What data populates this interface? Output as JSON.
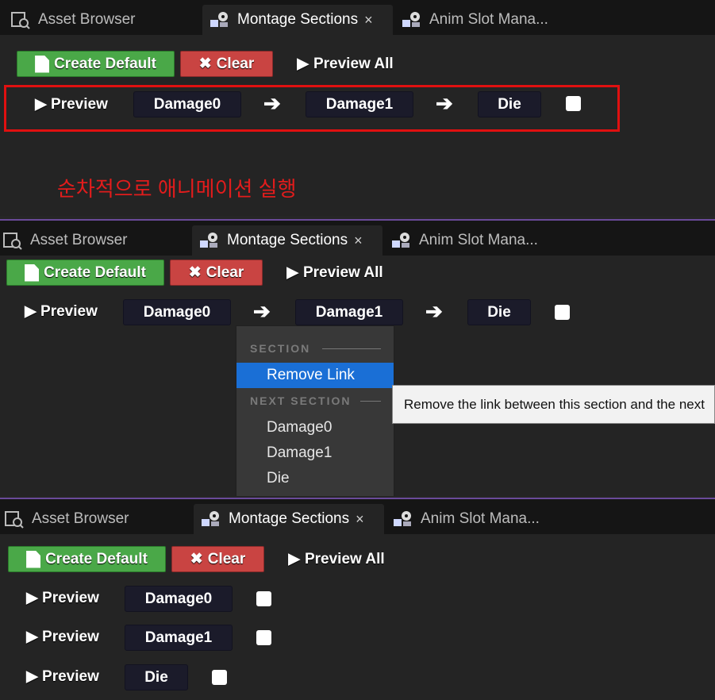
{
  "panels": [
    {
      "tabs": {
        "asset_browser": "Asset Browser",
        "montage_sections": "Montage Sections",
        "close": "×",
        "anim_slot": "Anim Slot Mana..."
      },
      "toolbar": {
        "create_default": "Create Default",
        "clear_glyph": "✖",
        "clear": "Clear",
        "preview_all_glyph": "▶",
        "preview_all": "Preview All"
      },
      "rows": [
        {
          "preview": "▶ Preview",
          "sections": [
            "Damage0",
            "Damage1",
            "Die"
          ],
          "arrow": "➔"
        }
      ],
      "caption": "순차적으로 애니메이션 실행"
    },
    {
      "tabs": {
        "asset_browser": "Asset Browser",
        "montage_sections": "Montage Sections",
        "close": "×",
        "anim_slot": "Anim Slot Mana..."
      },
      "toolbar": {
        "create_default": "Create Default",
        "clear_glyph": "✖",
        "clear": "Clear",
        "preview_all_glyph": "▶",
        "preview_all": "Preview All"
      },
      "rows": [
        {
          "preview": "▶ Preview",
          "sections": [
            "Damage0",
            "Damage1",
            "Die"
          ],
          "arrow": "➔"
        }
      ],
      "context_menu": {
        "section_header": "SECTION",
        "remove_link": "Remove Link",
        "next_section_header": "NEXT SECTION",
        "next_items": [
          "Damage0",
          "Damage1",
          "Die"
        ]
      },
      "tooltip": "Remove the link between this section and the next"
    },
    {
      "tabs": {
        "asset_browser": "Asset Browser",
        "montage_sections": "Montage Sections",
        "close": "×",
        "anim_slot": "Anim Slot Mana..."
      },
      "toolbar": {
        "create_default": "Create Default",
        "clear_glyph": "✖",
        "clear": "Clear",
        "preview_all_glyph": "▶",
        "preview_all": "Preview All"
      },
      "rows": [
        {
          "preview": "▶ Preview",
          "sections": [
            "Damage0"
          ]
        },
        {
          "preview": "▶ Preview",
          "sections": [
            "Damage1"
          ]
        },
        {
          "preview": "▶ Preview",
          "sections": [
            "Die"
          ]
        }
      ]
    }
  ],
  "colors": {
    "create_default": "#4aa848",
    "clear": "#c94442",
    "highlight": "#e01010",
    "caption": "#e21c1c",
    "menu_selected": "#1a6fd6"
  }
}
